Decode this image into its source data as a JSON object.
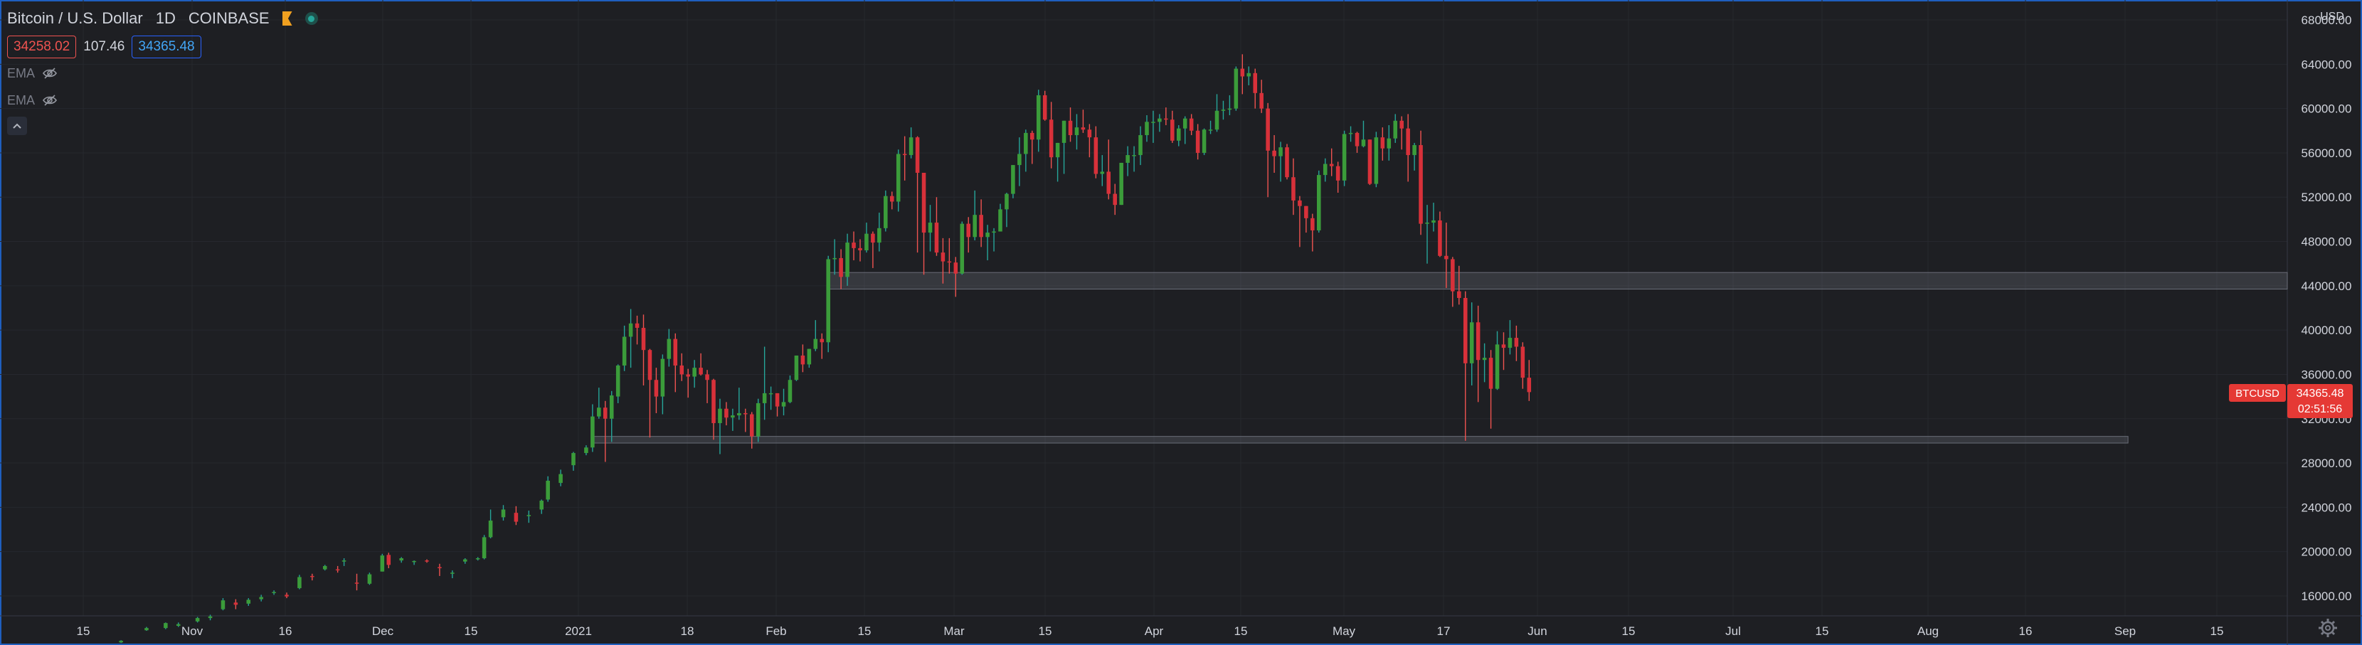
{
  "header": {
    "symbol": "Bitcoin / U.S. Dollar",
    "interval": "1D",
    "exchange": "COINBASE",
    "sell_price": "34258.02",
    "spread": "107.46",
    "buy_price": "34365.48"
  },
  "indicators": [
    {
      "label": "EMA"
    },
    {
      "label": "EMA"
    }
  ],
  "chart_data": {
    "type": "candlestick",
    "currency_label": "USD",
    "ylim": [
      14200,
      69800
    ],
    "y_ticks": [
      "16000.00",
      "20000.00",
      "24000.00",
      "28000.00",
      "32000.00",
      "36000.00",
      "40000.00",
      "44000.00",
      "48000.00",
      "52000.00",
      "56000.00",
      "60000.00",
      "64000.00",
      "68000.00"
    ],
    "x_labels": [
      "15",
      "Nov",
      "16",
      "Dec",
      "15",
      "2021",
      "18",
      "Feb",
      "15",
      "Mar",
      "15",
      "Apr",
      "15",
      "May",
      "17",
      "Jun",
      "15",
      "Jul",
      "15",
      "Aug",
      "16",
      "Sep",
      "15"
    ],
    "start_date": "2020-10-01",
    "end_date": "2021-09-25",
    "last_price_label": {
      "symbol": "BTCUSD",
      "price": "34365.48",
      "countdown": "02:51:56"
    },
    "zones": [
      {
        "from_date": "2021-02-08",
        "to_date": "2021-09-25",
        "low": 43700,
        "high": 45200
      },
      {
        "from_date": "2021-01-02",
        "to_date": "2021-08-31",
        "low": 29800,
        "high": 30400
      }
    ],
    "candles": [
      [
        "2020-10-20",
        11800,
        12000,
        11750,
        11950
      ],
      [
        "2020-10-24",
        12900,
        13200,
        12850,
        13100
      ],
      [
        "2020-10-27",
        13100,
        13600,
        13000,
        13550
      ],
      [
        "2020-10-29",
        13300,
        13600,
        13200,
        13450
      ],
      [
        "2020-11-01",
        13700,
        14100,
        13600,
        14000
      ],
      [
        "2020-11-03",
        14000,
        14300,
        13800,
        14150
      ],
      [
        "2020-11-05",
        14800,
        15800,
        14700,
        15600
      ],
      [
        "2020-11-07",
        15400,
        15700,
        14800,
        15200
      ],
      [
        "2020-11-09",
        15300,
        15800,
        15100,
        15650
      ],
      [
        "2020-11-11",
        15700,
        16100,
        15500,
        15900
      ],
      [
        "2020-11-13",
        16300,
        16500,
        16100,
        16350
      ],
      [
        "2020-11-15",
        16100,
        16300,
        15800,
        15950
      ],
      [
        "2020-11-17",
        16700,
        17900,
        16600,
        17700
      ],
      [
        "2020-11-19",
        17800,
        18000,
        17400,
        17750
      ],
      [
        "2020-11-21",
        18400,
        18800,
        18300,
        18700
      ],
      [
        "2020-11-23",
        18400,
        18700,
        18100,
        18350
      ],
      [
        "2020-11-24",
        19100,
        19400,
        18700,
        19200
      ],
      [
        "2020-11-26",
        17200,
        18000,
        16500,
        17100
      ],
      [
        "2020-11-28",
        17100,
        18100,
        17000,
        17950
      ],
      [
        "2020-11-30",
        18200,
        19800,
        18200,
        19650
      ],
      [
        "2020-12-01",
        19700,
        19900,
        18500,
        18800
      ],
      [
        "2020-12-03",
        19200,
        19500,
        19000,
        19400
      ],
      [
        "2020-12-05",
        19100,
        19200,
        18800,
        19150
      ],
      [
        "2020-12-07",
        19200,
        19300,
        19000,
        19150
      ],
      [
        "2020-12-09",
        18600,
        18900,
        17800,
        18500
      ],
      [
        "2020-12-11",
        18000,
        18300,
        17600,
        18100
      ],
      [
        "2020-12-13",
        19100,
        19400,
        18900,
        19300
      ],
      [
        "2020-12-15",
        19300,
        19500,
        19200,
        19400
      ],
      [
        "2020-12-16",
        19400,
        21500,
        19300,
        21300
      ],
      [
        "2020-12-17",
        21300,
        23800,
        21200,
        22800
      ],
      [
        "2020-12-19",
        23100,
        24200,
        22800,
        23800
      ],
      [
        "2020-12-21",
        23500,
        24100,
        22400,
        22700
      ],
      [
        "2020-12-23",
        23200,
        23700,
        22600,
        23300
      ],
      [
        "2020-12-25",
        23800,
        24700,
        23400,
        24600
      ],
      [
        "2020-12-26",
        24700,
        26800,
        24500,
        26400
      ],
      [
        "2020-12-28",
        26200,
        27400,
        25900,
        27000
      ],
      [
        "2020-12-30",
        27800,
        29000,
        27300,
        28900
      ],
      [
        "2021-01-01",
        28900,
        29600,
        28700,
        29400
      ],
      [
        "2021-01-02",
        29400,
        33300,
        29000,
        32200
      ],
      [
        "2021-01-03",
        32200,
        34800,
        32000,
        33000
      ],
      [
        "2021-01-04",
        33000,
        33600,
        28100,
        32000
      ],
      [
        "2021-01-05",
        32000,
        34500,
        29900,
        34100
      ],
      [
        "2021-01-06",
        34000,
        36900,
        33400,
        36800
      ],
      [
        "2021-01-07",
        36800,
        40400,
        36300,
        39400
      ],
      [
        "2021-01-08",
        39400,
        41900,
        36600,
        40600
      ],
      [
        "2021-01-09",
        40600,
        41300,
        38700,
        40200
      ],
      [
        "2021-01-10",
        40200,
        41400,
        35000,
        38200
      ],
      [
        "2021-01-11",
        38200,
        38300,
        30300,
        35500
      ],
      [
        "2021-01-12",
        35500,
        36600,
        32500,
        34000
      ],
      [
        "2021-01-13",
        34000,
        37800,
        32400,
        37400
      ],
      [
        "2021-01-14",
        37400,
        40100,
        36700,
        39200
      ],
      [
        "2021-01-15",
        39200,
        39700,
        34400,
        36800
      ],
      [
        "2021-01-16",
        36800,
        37900,
        35400,
        36000
      ],
      [
        "2021-01-17",
        36000,
        36500,
        33900,
        35800
      ],
      [
        "2021-01-18",
        35800,
        37300,
        34800,
        36600
      ],
      [
        "2021-01-19",
        36600,
        37900,
        35900,
        36000
      ],
      [
        "2021-01-20",
        36000,
        36400,
        33400,
        35500
      ],
      [
        "2021-01-21",
        35500,
        35600,
        30100,
        31600
      ],
      [
        "2021-01-22",
        31600,
        33800,
        28800,
        32900
      ],
      [
        "2021-01-23",
        32900,
        33500,
        31400,
        32100
      ],
      [
        "2021-01-24",
        32100,
        32900,
        30900,
        32300
      ],
      [
        "2021-01-25",
        32300,
        34800,
        31900,
        32500
      ],
      [
        "2021-01-26",
        32500,
        32900,
        30800,
        32400
      ],
      [
        "2021-01-27",
        32400,
        32600,
        29300,
        30400
      ],
      [
        "2021-01-28",
        30400,
        33800,
        29900,
        33400
      ],
      [
        "2021-01-29",
        33400,
        38500,
        31900,
        34300
      ],
      [
        "2021-01-30",
        34300,
        34900,
        32800,
        34300
      ],
      [
        "2021-01-31",
        34300,
        34300,
        32200,
        33100
      ],
      [
        "2021-02-01",
        33100,
        34700,
        32300,
        33500
      ],
      [
        "2021-02-02",
        33500,
        35900,
        33400,
        35500
      ],
      [
        "2021-02-03",
        35500,
        37700,
        35400,
        37700
      ],
      [
        "2021-02-04",
        37700,
        38700,
        36200,
        36900
      ],
      [
        "2021-02-05",
        36900,
        38300,
        36600,
        38300
      ],
      [
        "2021-02-06",
        38300,
        40900,
        38100,
        39200
      ],
      [
        "2021-02-07",
        39200,
        39700,
        37400,
        38900
      ],
      [
        "2021-02-08",
        38900,
        46700,
        38000,
        46400
      ],
      [
        "2021-02-09",
        46400,
        48200,
        45000,
        46500
      ],
      [
        "2021-02-10",
        46500,
        47300,
        43700,
        44800
      ],
      [
        "2021-02-11",
        44800,
        48700,
        44000,
        47900
      ],
      [
        "2021-02-12",
        47900,
        48900,
        46300,
        47400
      ],
      [
        "2021-02-13",
        47400,
        48200,
        46200,
        47200
      ],
      [
        "2021-02-14",
        47200,
        49700,
        47000,
        48700
      ],
      [
        "2021-02-15",
        48700,
        48900,
        45600,
        47900
      ],
      [
        "2021-02-16",
        47900,
        50600,
        47100,
        49200
      ],
      [
        "2021-02-17",
        49200,
        52600,
        48900,
        52100
      ],
      [
        "2021-02-18",
        52100,
        52500,
        50900,
        51600
      ],
      [
        "2021-02-19",
        51600,
        56300,
        50700,
        55900
      ],
      [
        "2021-02-20",
        55900,
        57500,
        53500,
        55800
      ],
      [
        "2021-02-21",
        55800,
        58300,
        55500,
        57400
      ],
      [
        "2021-02-22",
        57400,
        57500,
        47000,
        54200
      ],
      [
        "2021-02-23",
        54200,
        54200,
        45000,
        48800
      ],
      [
        "2021-02-24",
        48800,
        51300,
        47100,
        49700
      ],
      [
        "2021-02-25",
        49700,
        52000,
        46700,
        47000
      ],
      [
        "2021-02-26",
        47000,
        48300,
        44200,
        46200
      ],
      [
        "2021-02-27",
        46200,
        48300,
        45100,
        46100
      ],
      [
        "2021-02-28",
        46100,
        46600,
        43000,
        45100
      ],
      [
        "2021-03-01",
        45100,
        49800,
        45000,
        49600
      ],
      [
        "2021-03-02",
        49600,
        50200,
        47000,
        48400
      ],
      [
        "2021-03-03",
        48400,
        52600,
        48100,
        50400
      ],
      [
        "2021-03-04",
        50400,
        51800,
        47500,
        48400
      ],
      [
        "2021-03-05",
        48400,
        49500,
        46300,
        48800
      ],
      [
        "2021-03-06",
        48800,
        49200,
        47100,
        48900
      ],
      [
        "2021-03-07",
        48900,
        51400,
        48900,
        50900
      ],
      [
        "2021-03-08",
        50900,
        52400,
        49300,
        52300
      ],
      [
        "2021-03-09",
        52300,
        54900,
        51900,
        54900
      ],
      [
        "2021-03-10",
        54900,
        57400,
        53000,
        55900
      ],
      [
        "2021-03-11",
        55900,
        58100,
        54300,
        57800
      ],
      [
        "2021-03-12",
        57800,
        58000,
        55000,
        57200
      ],
      [
        "2021-03-13",
        57200,
        61700,
        56100,
        61200
      ],
      [
        "2021-03-14",
        61200,
        61600,
        58900,
        59000
      ],
      [
        "2021-03-15",
        59000,
        60600,
        54600,
        55600
      ],
      [
        "2021-03-16",
        55600,
        56900,
        53400,
        56900
      ],
      [
        "2021-03-17",
        56900,
        58900,
        54100,
        58900
      ],
      [
        "2021-03-18",
        58900,
        60100,
        57000,
        57600
      ],
      [
        "2021-03-19",
        57600,
        59500,
        56300,
        58300
      ],
      [
        "2021-03-20",
        58300,
        59900,
        57800,
        58100
      ],
      [
        "2021-03-21",
        58100,
        58600,
        55600,
        57400
      ],
      [
        "2021-03-22",
        57400,
        58400,
        53700,
        54100
      ],
      [
        "2021-03-23",
        54100,
        55800,
        53000,
        54300
      ],
      [
        "2021-03-24",
        54300,
        57200,
        51800,
        52300
      ],
      [
        "2021-03-25",
        52300,
        53200,
        50400,
        51300
      ],
      [
        "2021-03-26",
        51300,
        55100,
        51300,
        55100
      ],
      [
        "2021-03-27",
        55100,
        56600,
        53900,
        55800
      ],
      [
        "2021-03-28",
        55800,
        56600,
        54300,
        55800
      ],
      [
        "2021-03-29",
        55800,
        58400,
        54900,
        57600
      ],
      [
        "2021-03-30",
        57600,
        59400,
        57000,
        58800
      ],
      [
        "2021-03-31",
        58800,
        59800,
        56900,
        58800
      ],
      [
        "2021-04-01",
        58800,
        59500,
        57900,
        59100
      ],
      [
        "2021-04-02",
        59100,
        60100,
        58500,
        59000
      ],
      [
        "2021-04-03",
        59000,
        59800,
        56900,
        57100
      ],
      [
        "2021-04-04",
        57100,
        58500,
        56600,
        58200
      ],
      [
        "2021-04-05",
        58200,
        59300,
        56800,
        59100
      ],
      [
        "2021-04-06",
        59100,
        59500,
        57600,
        58000
      ],
      [
        "2021-04-07",
        58000,
        58600,
        55400,
        56000
      ],
      [
        "2021-04-08",
        56000,
        58200,
        55800,
        58100
      ],
      [
        "2021-04-09",
        58100,
        58900,
        57700,
        58100
      ],
      [
        "2021-04-10",
        58100,
        61300,
        57900,
        59800
      ],
      [
        "2021-04-11",
        59800,
        60700,
        59000,
        59900
      ],
      [
        "2021-04-12",
        59900,
        61200,
        59400,
        60000
      ],
      [
        "2021-04-13",
        60000,
        63800,
        59800,
        63600
      ],
      [
        "2021-04-14",
        63600,
        64900,
        61300,
        62900
      ],
      [
        "2021-04-15",
        62900,
        63800,
        62100,
        63200
      ],
      [
        "2021-04-16",
        63200,
        63600,
        60000,
        61400
      ],
      [
        "2021-04-17",
        61400,
        62600,
        59600,
        60000
      ],
      [
        "2021-04-18",
        60000,
        60500,
        52000,
        56200
      ],
      [
        "2021-04-19",
        56200,
        57600,
        54200,
        55700
      ],
      [
        "2021-04-20",
        55700,
        57000,
        53400,
        56500
      ],
      [
        "2021-04-21",
        56500,
        56800,
        53600,
        53800
      ],
      [
        "2021-04-22",
        53800,
        55500,
        50400,
        51700
      ],
      [
        "2021-04-23",
        51700,
        52100,
        47500,
        51200
      ],
      [
        "2021-04-24",
        51200,
        51200,
        48800,
        50100
      ],
      [
        "2021-04-25",
        50100,
        50500,
        47100,
        49000
      ],
      [
        "2021-04-26",
        49000,
        54400,
        48800,
        54000
      ],
      [
        "2021-04-27",
        54000,
        55500,
        53400,
        55000
      ],
      [
        "2021-04-28",
        55000,
        56400,
        53900,
        54800
      ],
      [
        "2021-04-29",
        54800,
        55200,
        52400,
        53500
      ],
      [
        "2021-04-30",
        53500,
        58000,
        53000,
        57700
      ],
      [
        "2021-05-01",
        57700,
        58400,
        57000,
        57800
      ],
      [
        "2021-05-02",
        57800,
        57900,
        56000,
        56600
      ],
      [
        "2021-05-03",
        56600,
        58900,
        56500,
        57200
      ],
      [
        "2021-05-04",
        57200,
        57200,
        53100,
        53200
      ],
      [
        "2021-05-05",
        53200,
        57900,
        52900,
        57400
      ],
      [
        "2021-05-06",
        57400,
        58300,
        55300,
        56400
      ],
      [
        "2021-05-07",
        56400,
        58500,
        55300,
        57300
      ],
      [
        "2021-05-08",
        57300,
        59500,
        56900,
        58900
      ],
      [
        "2021-05-09",
        58900,
        59300,
        56300,
        58200
      ],
      [
        "2021-05-10",
        58200,
        59500,
        53400,
        55800
      ],
      [
        "2021-05-11",
        55800,
        56900,
        54400,
        56700
      ],
      [
        "2021-05-12",
        56700,
        58000,
        48600,
        49600
      ],
      [
        "2021-05-13",
        49600,
        51300,
        46000,
        49700
      ],
      [
        "2021-05-14",
        49700,
        51500,
        48900,
        49900
      ],
      [
        "2021-05-15",
        49900,
        50700,
        46600,
        46700
      ],
      [
        "2021-05-16",
        46700,
        49700,
        43800,
        46400
      ],
      [
        "2021-05-17",
        46400,
        46600,
        42100,
        43500
      ],
      [
        "2021-05-18",
        43500,
        45800,
        42300,
        42900
      ],
      [
        "2021-05-19",
        42900,
        43500,
        30000,
        37000
      ],
      [
        "2021-05-20",
        37000,
        42500,
        35000,
        40700
      ],
      [
        "2021-05-21",
        40700,
        42200,
        33500,
        37300
      ],
      [
        "2021-05-22",
        37300,
        38800,
        35300,
        37500
      ],
      [
        "2021-05-23",
        37500,
        38200,
        31100,
        34700
      ],
      [
        "2021-05-24",
        34700,
        39900,
        34600,
        38700
      ],
      [
        "2021-05-25",
        38700,
        39800,
        36400,
        38400
      ],
      [
        "2021-05-26",
        38400,
        40900,
        37800,
        39300
      ],
      [
        "2021-05-27",
        39300,
        40400,
        37200,
        38500
      ],
      [
        "2021-05-28",
        38500,
        38900,
        34700,
        35700
      ],
      [
        "2021-05-29",
        35700,
        37300,
        33600,
        34400
      ]
    ]
  }
}
